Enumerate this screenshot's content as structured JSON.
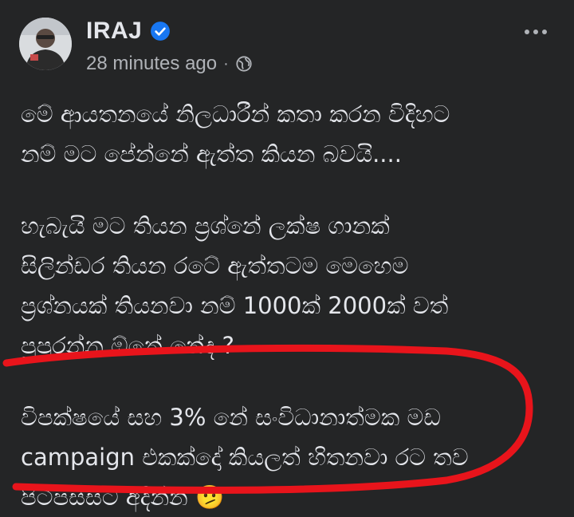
{
  "post": {
    "author": "IRAJ",
    "timestamp": "28 minutes ago",
    "separator": "·",
    "audience_icon": "globe-icon",
    "verified_icon": "verified-badge-icon",
    "more_icon": "more-options-icon",
    "paragraphs": [
      "මේ ආයතනයේ නිලධාරීන් කතා කරන විදිහට\nනම් මට පේන්නේ ඇත්ත කියන බවයි....",
      "හැබැයි මට තියන ප්‍රශ්නේ ලක්ෂ ගානක්\nසිලින්ඩර තියන රටේ ඇත්තටම මෙහෙම\nප්‍රශ්නයක් තියනවා නම් 1000ක් 2000ක් වත්\nපුපුරන්න ඕනේ නේද ?",
      "විපක්ෂයේ සහ 3% නේ සංවිධානාත්මක මඩ\ncampaign එකක්දෝ කියලත් හිතනවා රට තව\nපිටිපස්සට අදින්න 🫤"
    ]
  },
  "colors": {
    "background": "#242526",
    "text_primary": "#e4e6eb",
    "text_secondary": "#b0b3b8",
    "verified_blue": "#1877f2",
    "annotation_red": "#e8141b"
  }
}
